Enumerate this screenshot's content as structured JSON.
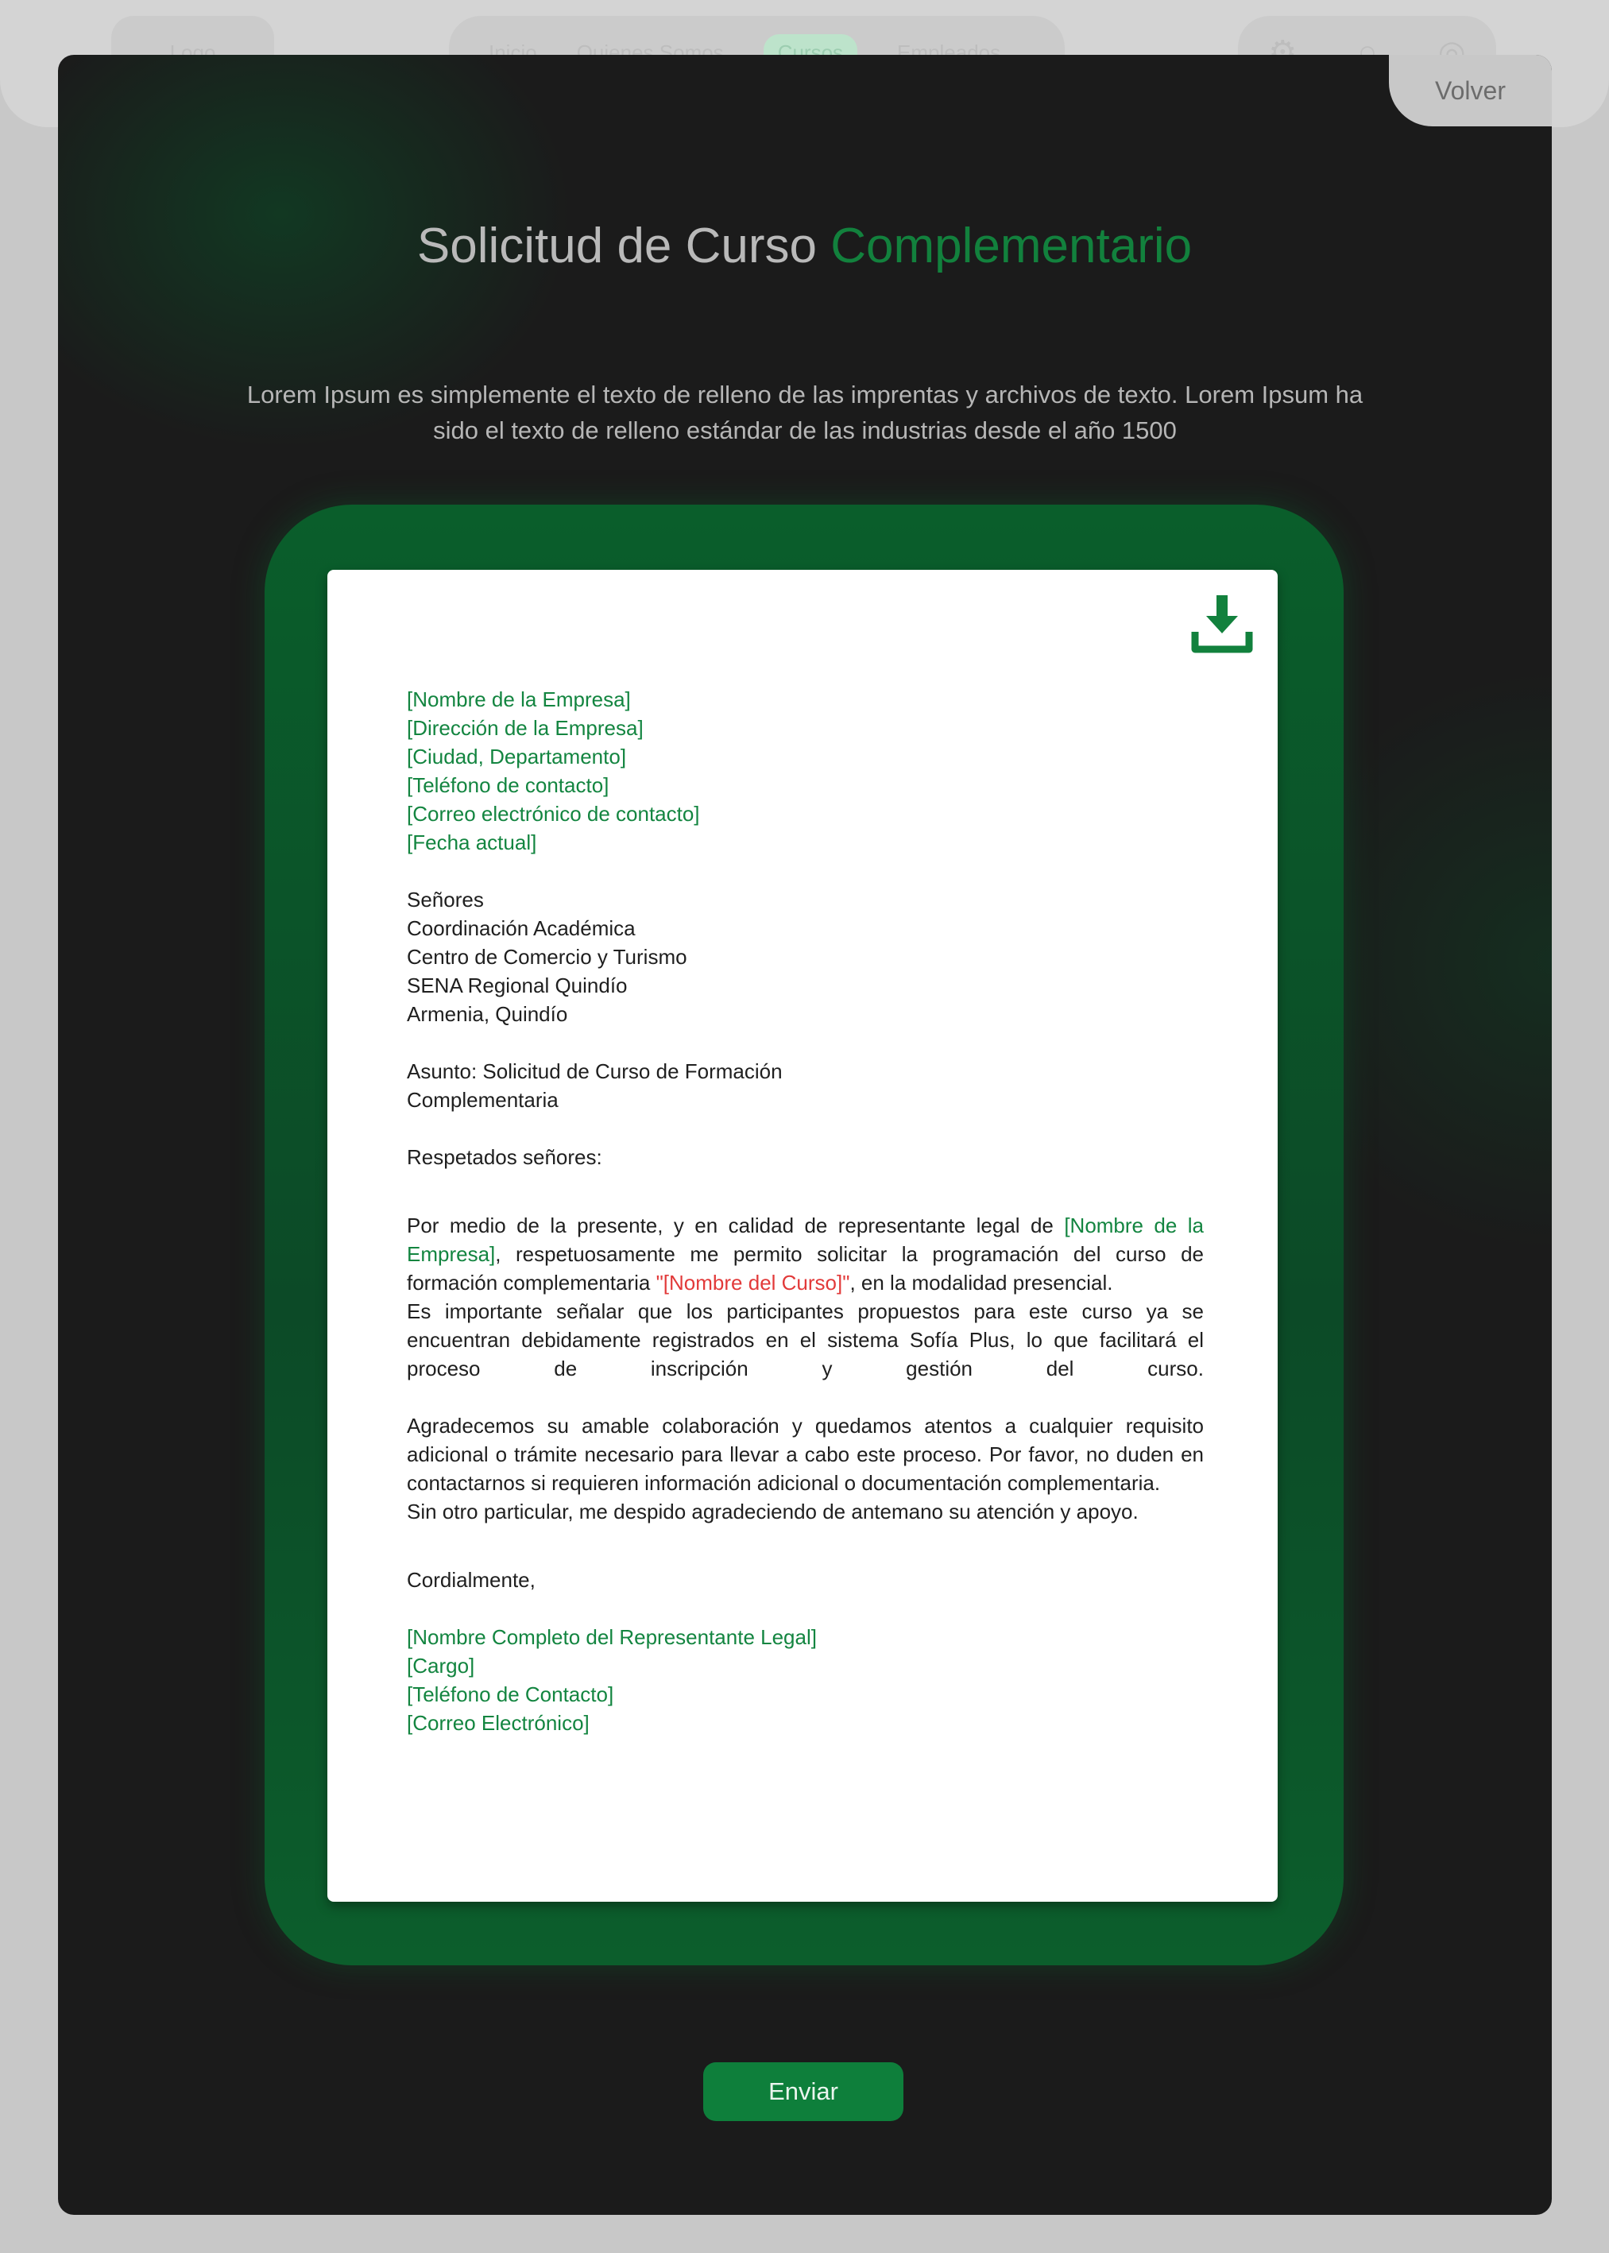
{
  "nav": {
    "logo": "Logo",
    "links": [
      "Inicio",
      "Quienes Somos",
      "Cursos",
      "Empleados"
    ],
    "active_link": "Cursos"
  },
  "modal": {
    "back_label": "Volver",
    "title_part1": "Solicitud de Curso",
    "title_part2": "Complementario",
    "description": "Lorem Ipsum es simplemente el texto de relleno de las imprentas y archivos de texto. Lorem Ipsum ha sido el texto de relleno estándar de las industrias desde el año 1500",
    "submit_label": "Enviar"
  },
  "letter": {
    "sender": {
      "company": "[Nombre de la Empresa]",
      "address": "[Dirección de la Empresa]",
      "city": "[Ciudad, Departamento]",
      "phone": "[Teléfono de contacto]",
      "email": "[Correo electrónico de contacto]",
      "date": "[Fecha actual]"
    },
    "recipient": {
      "salutation_line": "Señores",
      "line1": "Coordinación Académica",
      "line2": "Centro de Comercio y Turismo",
      "line3": "SENA Regional Quindío",
      "line4": "Armenia, Quindío"
    },
    "subject_line1": "Asunto: Solicitud de Curso de Formación",
    "subject_line2": "Complementaria",
    "greeting": "Respetados señores:",
    "p1_a": "Por medio de la presente, y en calidad de representante legal de ",
    "p1_company": "[Nombre de la Empresa]",
    "p1_b": ", respetuosamente me permito solicitar la programación del curso de formación complementaria ",
    "p1_course": "\"[Nombre del Curso]\"",
    "p1_c": ", en la modalidad presencial.",
    "p2": "Es importante señalar que los participantes propuestos para este curso ya se encuentran debidamente registrados en el sistema Sofía Plus, lo que facilitará el proceso de inscripción y gestión del curso.",
    "p3": "Agradecemos su amable colaboración y quedamos atentos a cualquier requisito adicional o trámite necesario para llevar a cabo este proceso. Por favor, no duden en contactarnos si requieren información adicional o documentación complementaria.",
    "p4": "Sin otro particular, me despido agradeciendo de antemano su atención y apoyo.",
    "closing": "Cordialmente,",
    "signature": {
      "name": "[Nombre Completo del Representante Legal]",
      "role": "[Cargo]",
      "phone": "[Teléfono de Contacto]",
      "email": "[Correo Electrónico]"
    }
  },
  "icons": {
    "download": "download-icon",
    "settings": "gear-icon",
    "notifications": "drop-icon",
    "user": "user-icon"
  },
  "colors": {
    "accent": "#12813d",
    "placeholder": "#138540",
    "course_placeholder": "#e23a3a",
    "modal_bg": "#1b1b1b"
  }
}
